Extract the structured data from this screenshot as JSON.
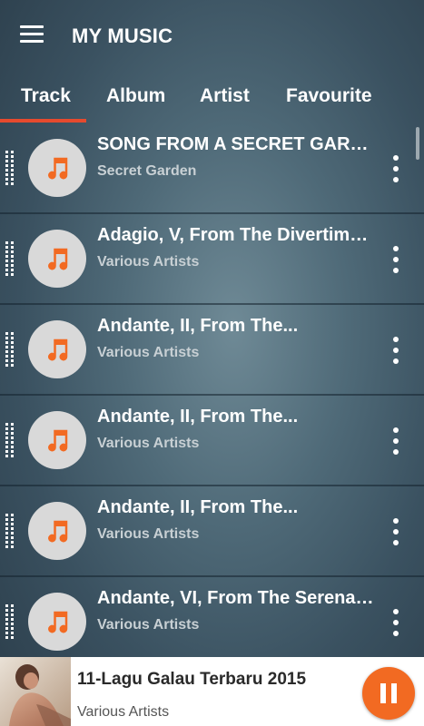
{
  "app": {
    "title": "MY MUSIC"
  },
  "tabs": [
    {
      "label": "Track",
      "active": true
    },
    {
      "label": "Album",
      "active": false
    },
    {
      "label": "Artist",
      "active": false
    },
    {
      "label": "Favourite",
      "active": false
    }
  ],
  "tracks": [
    {
      "title": "SONG FROM A SECRET GARDEN",
      "artist": "Secret Garden"
    },
    {
      "title": "Adagio, V, From The Divertimento...",
      "artist": "Various Artists"
    },
    {
      "title": "Andante, II, From The...",
      "artist": "Various Artists"
    },
    {
      "title": "Andante, II, From The...",
      "artist": "Various Artists"
    },
    {
      "title": "Andante, II, From The...",
      "artist": "Various Artists"
    },
    {
      "title": "Andante, VI, From The Serenade...",
      "artist": "Various Artists"
    }
  ],
  "icons": {
    "menu": "hamburger-menu-icon",
    "drag": "drag-handle-icon",
    "music": "music-note-icon",
    "more": "more-vertical-icon",
    "pause": "pause-icon"
  },
  "colors": {
    "accent": "#e64a2e",
    "note": "#f26a22",
    "art_bg": "#d9d9d9",
    "pause_bg": "#f26a22"
  },
  "now_playing": {
    "title": "11-Lagu Galau Terbaru 2015",
    "artist": "Various Artists"
  }
}
